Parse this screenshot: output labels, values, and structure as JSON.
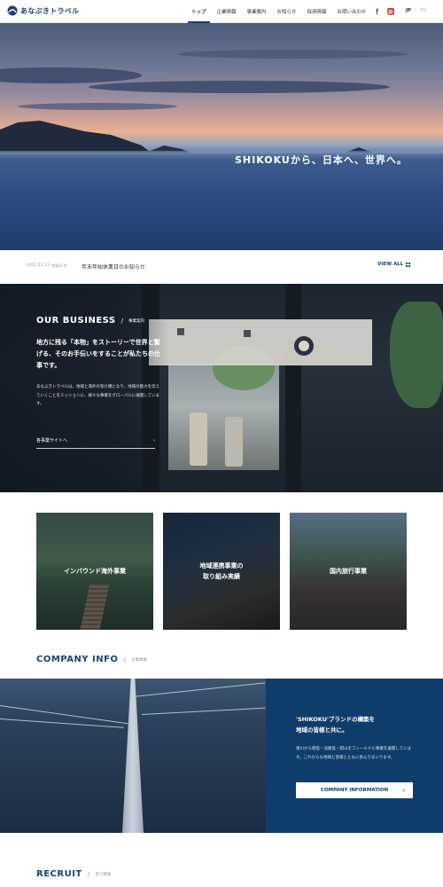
{
  "brand": {
    "logo_text": "あなぶきトラベル",
    "color": "#1d3f76"
  },
  "nav": {
    "items": [
      {
        "label": "トップ",
        "active": true
      },
      {
        "label": "企業情報",
        "active": false
      },
      {
        "label": "事業案内",
        "active": false
      },
      {
        "label": "お知らせ",
        "active": false
      },
      {
        "label": "採用情報",
        "active": false
      },
      {
        "label": "お問い合わせ",
        "active": false
      }
    ],
    "social": [
      "facebook-icon",
      "instagram-icon"
    ],
    "lang": {
      "current": "JP",
      "separator": "|",
      "other": "EN"
    }
  },
  "hero": {
    "tagline": "SHIKOKUから、日本へ、世界へ。"
  },
  "news": {
    "date": "2021.12.17",
    "category": "お知らせ",
    "title": "年末年始休業日のお知らせ",
    "view_all": "VIEW ALL"
  },
  "business": {
    "heading_en": "OUR BUSINESS",
    "heading_sep": "/",
    "heading_jp": "事業案内",
    "lead": "地方に残る「本物」をストーリーで世界と繋げる、そのお手伝いをすることが私たちの仕事です。",
    "body": "あなぶきトラベルは、地域と海外の架け橋となり、地域の魅力を伝えていくことをミッションに、様々な事業をグローバルに展開しています。",
    "link_label": "各事業サイトへ",
    "link_arrow": "›"
  },
  "cards": [
    {
      "label": "インバウンド海外事業"
    },
    {
      "label": "地域連携事業の\n取り組み実績"
    },
    {
      "label": "国内旅行事業"
    }
  ],
  "company": {
    "heading_en": "COMPANY INFO",
    "heading_sep": "/",
    "heading_jp": "企業情報",
    "title": "'SHIKOKU'ブランドの構築を\n地域の皆様と共に。",
    "body": "香川から徳島・淡路島・岡山をフィールドに事業を展開しています。これからも地域と皆様とともに歩んでまいります。",
    "button_label": "COMPANY INFORMATION",
    "button_arrow": "›"
  },
  "recruit": {
    "heading_en": "RECRUIT",
    "heading_sep": "/",
    "heading_jp": "求人情報"
  }
}
